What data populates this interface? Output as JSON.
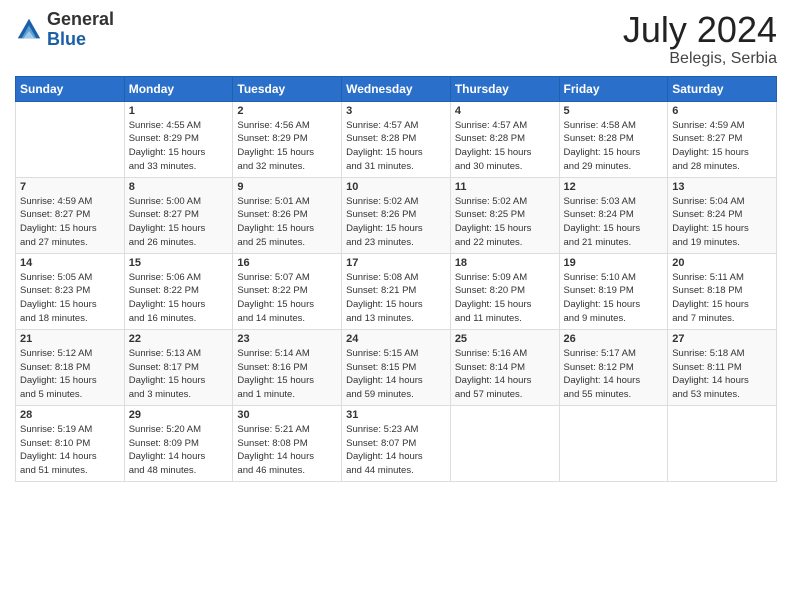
{
  "header": {
    "logo": {
      "general": "General",
      "blue": "Blue"
    },
    "title": "July 2024",
    "location": "Belegis, Serbia"
  },
  "weekdays": [
    "Sunday",
    "Monday",
    "Tuesday",
    "Wednesday",
    "Thursday",
    "Friday",
    "Saturday"
  ],
  "weeks": [
    [
      {
        "day": "",
        "info": ""
      },
      {
        "day": "1",
        "info": "Sunrise: 4:55 AM\nSunset: 8:29 PM\nDaylight: 15 hours\nand 33 minutes."
      },
      {
        "day": "2",
        "info": "Sunrise: 4:56 AM\nSunset: 8:29 PM\nDaylight: 15 hours\nand 32 minutes."
      },
      {
        "day": "3",
        "info": "Sunrise: 4:57 AM\nSunset: 8:28 PM\nDaylight: 15 hours\nand 31 minutes."
      },
      {
        "day": "4",
        "info": "Sunrise: 4:57 AM\nSunset: 8:28 PM\nDaylight: 15 hours\nand 30 minutes."
      },
      {
        "day": "5",
        "info": "Sunrise: 4:58 AM\nSunset: 8:28 PM\nDaylight: 15 hours\nand 29 minutes."
      },
      {
        "day": "6",
        "info": "Sunrise: 4:59 AM\nSunset: 8:27 PM\nDaylight: 15 hours\nand 28 minutes."
      }
    ],
    [
      {
        "day": "7",
        "info": "Sunrise: 4:59 AM\nSunset: 8:27 PM\nDaylight: 15 hours\nand 27 minutes."
      },
      {
        "day": "8",
        "info": "Sunrise: 5:00 AM\nSunset: 8:27 PM\nDaylight: 15 hours\nand 26 minutes."
      },
      {
        "day": "9",
        "info": "Sunrise: 5:01 AM\nSunset: 8:26 PM\nDaylight: 15 hours\nand 25 minutes."
      },
      {
        "day": "10",
        "info": "Sunrise: 5:02 AM\nSunset: 8:26 PM\nDaylight: 15 hours\nand 23 minutes."
      },
      {
        "day": "11",
        "info": "Sunrise: 5:02 AM\nSunset: 8:25 PM\nDaylight: 15 hours\nand 22 minutes."
      },
      {
        "day": "12",
        "info": "Sunrise: 5:03 AM\nSunset: 8:24 PM\nDaylight: 15 hours\nand 21 minutes."
      },
      {
        "day": "13",
        "info": "Sunrise: 5:04 AM\nSunset: 8:24 PM\nDaylight: 15 hours\nand 19 minutes."
      }
    ],
    [
      {
        "day": "14",
        "info": "Sunrise: 5:05 AM\nSunset: 8:23 PM\nDaylight: 15 hours\nand 18 minutes."
      },
      {
        "day": "15",
        "info": "Sunrise: 5:06 AM\nSunset: 8:22 PM\nDaylight: 15 hours\nand 16 minutes."
      },
      {
        "day": "16",
        "info": "Sunrise: 5:07 AM\nSunset: 8:22 PM\nDaylight: 15 hours\nand 14 minutes."
      },
      {
        "day": "17",
        "info": "Sunrise: 5:08 AM\nSunset: 8:21 PM\nDaylight: 15 hours\nand 13 minutes."
      },
      {
        "day": "18",
        "info": "Sunrise: 5:09 AM\nSunset: 8:20 PM\nDaylight: 15 hours\nand 11 minutes."
      },
      {
        "day": "19",
        "info": "Sunrise: 5:10 AM\nSunset: 8:19 PM\nDaylight: 15 hours\nand 9 minutes."
      },
      {
        "day": "20",
        "info": "Sunrise: 5:11 AM\nSunset: 8:18 PM\nDaylight: 15 hours\nand 7 minutes."
      }
    ],
    [
      {
        "day": "21",
        "info": "Sunrise: 5:12 AM\nSunset: 8:18 PM\nDaylight: 15 hours\nand 5 minutes."
      },
      {
        "day": "22",
        "info": "Sunrise: 5:13 AM\nSunset: 8:17 PM\nDaylight: 15 hours\nand 3 minutes."
      },
      {
        "day": "23",
        "info": "Sunrise: 5:14 AM\nSunset: 8:16 PM\nDaylight: 15 hours\nand 1 minute."
      },
      {
        "day": "24",
        "info": "Sunrise: 5:15 AM\nSunset: 8:15 PM\nDaylight: 14 hours\nand 59 minutes."
      },
      {
        "day": "25",
        "info": "Sunrise: 5:16 AM\nSunset: 8:14 PM\nDaylight: 14 hours\nand 57 minutes."
      },
      {
        "day": "26",
        "info": "Sunrise: 5:17 AM\nSunset: 8:12 PM\nDaylight: 14 hours\nand 55 minutes."
      },
      {
        "day": "27",
        "info": "Sunrise: 5:18 AM\nSunset: 8:11 PM\nDaylight: 14 hours\nand 53 minutes."
      }
    ],
    [
      {
        "day": "28",
        "info": "Sunrise: 5:19 AM\nSunset: 8:10 PM\nDaylight: 14 hours\nand 51 minutes."
      },
      {
        "day": "29",
        "info": "Sunrise: 5:20 AM\nSunset: 8:09 PM\nDaylight: 14 hours\nand 48 minutes."
      },
      {
        "day": "30",
        "info": "Sunrise: 5:21 AM\nSunset: 8:08 PM\nDaylight: 14 hours\nand 46 minutes."
      },
      {
        "day": "31",
        "info": "Sunrise: 5:23 AM\nSunset: 8:07 PM\nDaylight: 14 hours\nand 44 minutes."
      },
      {
        "day": "",
        "info": ""
      },
      {
        "day": "",
        "info": ""
      },
      {
        "day": "",
        "info": ""
      }
    ]
  ]
}
